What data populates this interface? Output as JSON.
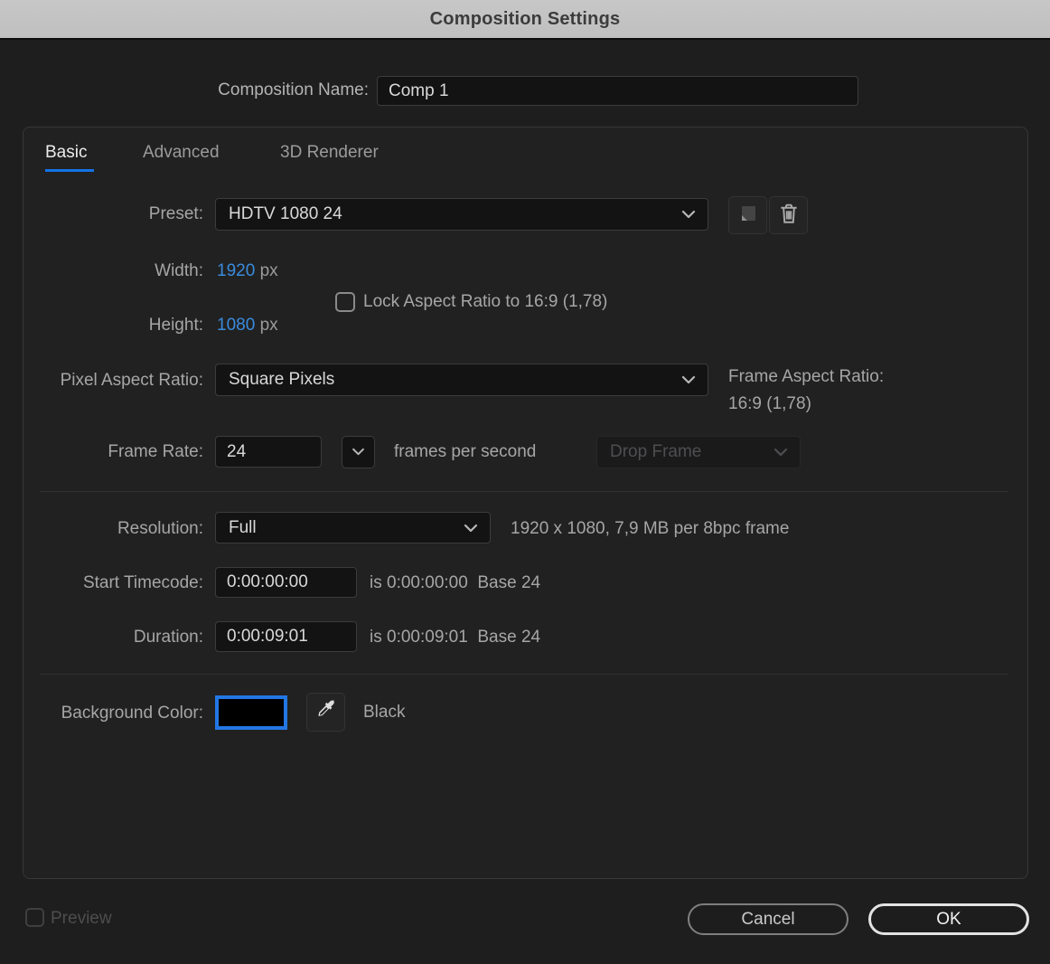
{
  "window": {
    "title": "Composition Settings"
  },
  "name_row": {
    "label": "Composition Name:",
    "value": "Comp 1"
  },
  "tabs": {
    "basic": "Basic",
    "advanced": "Advanced",
    "renderer": "3D Renderer",
    "active": "Basic"
  },
  "preset": {
    "label": "Preset:",
    "value": "HDTV 1080 24"
  },
  "dimensions": {
    "width_label": "Width:",
    "width_value": "1920",
    "width_unit": "px",
    "height_label": "Height:",
    "height_value": "1080",
    "height_unit": "px",
    "lock_label": "Lock Aspect Ratio to 16:9 (1,78)",
    "lock_checked": false
  },
  "pixel_aspect_ratio": {
    "label": "Pixel Aspect Ratio:",
    "value": "Square Pixels"
  },
  "frame_aspect_ratio": {
    "label": "Frame Aspect Ratio:",
    "value": "16:9 (1,78)"
  },
  "frame_rate": {
    "label": "Frame Rate:",
    "value": "24",
    "unit_label": "frames per second",
    "drop_frame_label": "Drop Frame",
    "drop_frame_enabled": false
  },
  "resolution": {
    "label": "Resolution:",
    "value": "Full",
    "info": "1920 x 1080, 7,9 MB per 8bpc frame"
  },
  "start_timecode": {
    "label": "Start Timecode:",
    "value": "0:00:00:00",
    "info": "is 0:00:00:00  Base 24"
  },
  "duration": {
    "label": "Duration:",
    "value": "0:00:09:01",
    "info": "is 0:00:09:01  Base 24"
  },
  "background_color": {
    "label": "Background Color:",
    "swatch_color": "#000000",
    "color_name": "Black"
  },
  "footer": {
    "preview_label": "Preview",
    "preview_checked": false,
    "preview_enabled": false,
    "cancel_label": "Cancel",
    "ok_label": "OK"
  },
  "colors": {
    "accent_blue": "#1473e6",
    "value_blue": "#3a8bdd",
    "swatch_border_blue": "#2377e4",
    "titlebar_gray": "#c3c3c3",
    "dialog_bg": "#1e1e1e"
  }
}
